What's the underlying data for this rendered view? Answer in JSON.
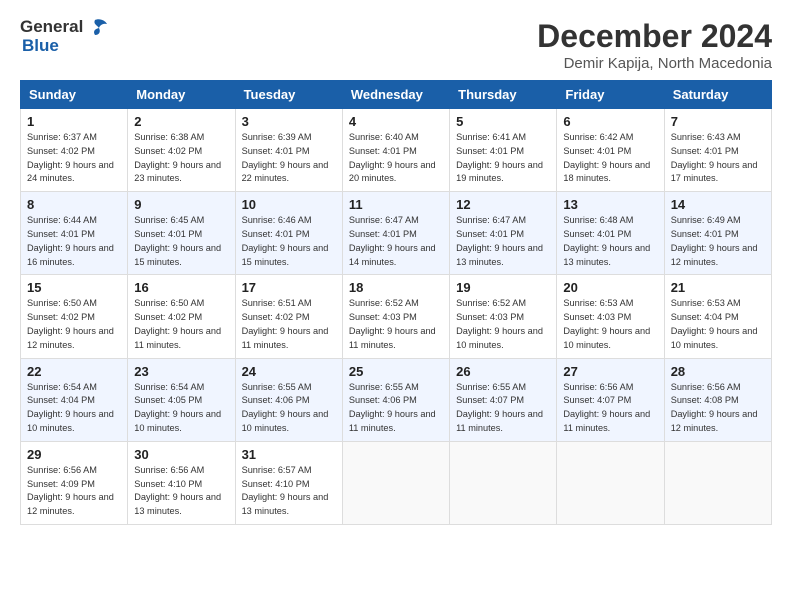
{
  "logo": {
    "general": "General",
    "blue": "Blue"
  },
  "header": {
    "month": "December 2024",
    "location": "Demir Kapija, North Macedonia"
  },
  "weekdays": [
    "Sunday",
    "Monday",
    "Tuesday",
    "Wednesday",
    "Thursday",
    "Friday",
    "Saturday"
  ],
  "weeks": [
    [
      {
        "day": "1",
        "sunrise": "Sunrise: 6:37 AM",
        "sunset": "Sunset: 4:02 PM",
        "daylight": "Daylight: 9 hours and 24 minutes."
      },
      {
        "day": "2",
        "sunrise": "Sunrise: 6:38 AM",
        "sunset": "Sunset: 4:02 PM",
        "daylight": "Daylight: 9 hours and 23 minutes."
      },
      {
        "day": "3",
        "sunrise": "Sunrise: 6:39 AM",
        "sunset": "Sunset: 4:01 PM",
        "daylight": "Daylight: 9 hours and 22 minutes."
      },
      {
        "day": "4",
        "sunrise": "Sunrise: 6:40 AM",
        "sunset": "Sunset: 4:01 PM",
        "daylight": "Daylight: 9 hours and 20 minutes."
      },
      {
        "day": "5",
        "sunrise": "Sunrise: 6:41 AM",
        "sunset": "Sunset: 4:01 PM",
        "daylight": "Daylight: 9 hours and 19 minutes."
      },
      {
        "day": "6",
        "sunrise": "Sunrise: 6:42 AM",
        "sunset": "Sunset: 4:01 PM",
        "daylight": "Daylight: 9 hours and 18 minutes."
      },
      {
        "day": "7",
        "sunrise": "Sunrise: 6:43 AM",
        "sunset": "Sunset: 4:01 PM",
        "daylight": "Daylight: 9 hours and 17 minutes."
      }
    ],
    [
      {
        "day": "8",
        "sunrise": "Sunrise: 6:44 AM",
        "sunset": "Sunset: 4:01 PM",
        "daylight": "Daylight: 9 hours and 16 minutes."
      },
      {
        "day": "9",
        "sunrise": "Sunrise: 6:45 AM",
        "sunset": "Sunset: 4:01 PM",
        "daylight": "Daylight: 9 hours and 15 minutes."
      },
      {
        "day": "10",
        "sunrise": "Sunrise: 6:46 AM",
        "sunset": "Sunset: 4:01 PM",
        "daylight": "Daylight: 9 hours and 15 minutes."
      },
      {
        "day": "11",
        "sunrise": "Sunrise: 6:47 AM",
        "sunset": "Sunset: 4:01 PM",
        "daylight": "Daylight: 9 hours and 14 minutes."
      },
      {
        "day": "12",
        "sunrise": "Sunrise: 6:47 AM",
        "sunset": "Sunset: 4:01 PM",
        "daylight": "Daylight: 9 hours and 13 minutes."
      },
      {
        "day": "13",
        "sunrise": "Sunrise: 6:48 AM",
        "sunset": "Sunset: 4:01 PM",
        "daylight": "Daylight: 9 hours and 13 minutes."
      },
      {
        "day": "14",
        "sunrise": "Sunrise: 6:49 AM",
        "sunset": "Sunset: 4:01 PM",
        "daylight": "Daylight: 9 hours and 12 minutes."
      }
    ],
    [
      {
        "day": "15",
        "sunrise": "Sunrise: 6:50 AM",
        "sunset": "Sunset: 4:02 PM",
        "daylight": "Daylight: 9 hours and 12 minutes."
      },
      {
        "day": "16",
        "sunrise": "Sunrise: 6:50 AM",
        "sunset": "Sunset: 4:02 PM",
        "daylight": "Daylight: 9 hours and 11 minutes."
      },
      {
        "day": "17",
        "sunrise": "Sunrise: 6:51 AM",
        "sunset": "Sunset: 4:02 PM",
        "daylight": "Daylight: 9 hours and 11 minutes."
      },
      {
        "day": "18",
        "sunrise": "Sunrise: 6:52 AM",
        "sunset": "Sunset: 4:03 PM",
        "daylight": "Daylight: 9 hours and 11 minutes."
      },
      {
        "day": "19",
        "sunrise": "Sunrise: 6:52 AM",
        "sunset": "Sunset: 4:03 PM",
        "daylight": "Daylight: 9 hours and 10 minutes."
      },
      {
        "day": "20",
        "sunrise": "Sunrise: 6:53 AM",
        "sunset": "Sunset: 4:03 PM",
        "daylight": "Daylight: 9 hours and 10 minutes."
      },
      {
        "day": "21",
        "sunrise": "Sunrise: 6:53 AM",
        "sunset": "Sunset: 4:04 PM",
        "daylight": "Daylight: 9 hours and 10 minutes."
      }
    ],
    [
      {
        "day": "22",
        "sunrise": "Sunrise: 6:54 AM",
        "sunset": "Sunset: 4:04 PM",
        "daylight": "Daylight: 9 hours and 10 minutes."
      },
      {
        "day": "23",
        "sunrise": "Sunrise: 6:54 AM",
        "sunset": "Sunset: 4:05 PM",
        "daylight": "Daylight: 9 hours and 10 minutes."
      },
      {
        "day": "24",
        "sunrise": "Sunrise: 6:55 AM",
        "sunset": "Sunset: 4:06 PM",
        "daylight": "Daylight: 9 hours and 10 minutes."
      },
      {
        "day": "25",
        "sunrise": "Sunrise: 6:55 AM",
        "sunset": "Sunset: 4:06 PM",
        "daylight": "Daylight: 9 hours and 11 minutes."
      },
      {
        "day": "26",
        "sunrise": "Sunrise: 6:55 AM",
        "sunset": "Sunset: 4:07 PM",
        "daylight": "Daylight: 9 hours and 11 minutes."
      },
      {
        "day": "27",
        "sunrise": "Sunrise: 6:56 AM",
        "sunset": "Sunset: 4:07 PM",
        "daylight": "Daylight: 9 hours and 11 minutes."
      },
      {
        "day": "28",
        "sunrise": "Sunrise: 6:56 AM",
        "sunset": "Sunset: 4:08 PM",
        "daylight": "Daylight: 9 hours and 12 minutes."
      }
    ],
    [
      {
        "day": "29",
        "sunrise": "Sunrise: 6:56 AM",
        "sunset": "Sunset: 4:09 PM",
        "daylight": "Daylight: 9 hours and 12 minutes."
      },
      {
        "day": "30",
        "sunrise": "Sunrise: 6:56 AM",
        "sunset": "Sunset: 4:10 PM",
        "daylight": "Daylight: 9 hours and 13 minutes."
      },
      {
        "day": "31",
        "sunrise": "Sunrise: 6:57 AM",
        "sunset": "Sunset: 4:10 PM",
        "daylight": "Daylight: 9 hours and 13 minutes."
      },
      null,
      null,
      null,
      null
    ]
  ]
}
